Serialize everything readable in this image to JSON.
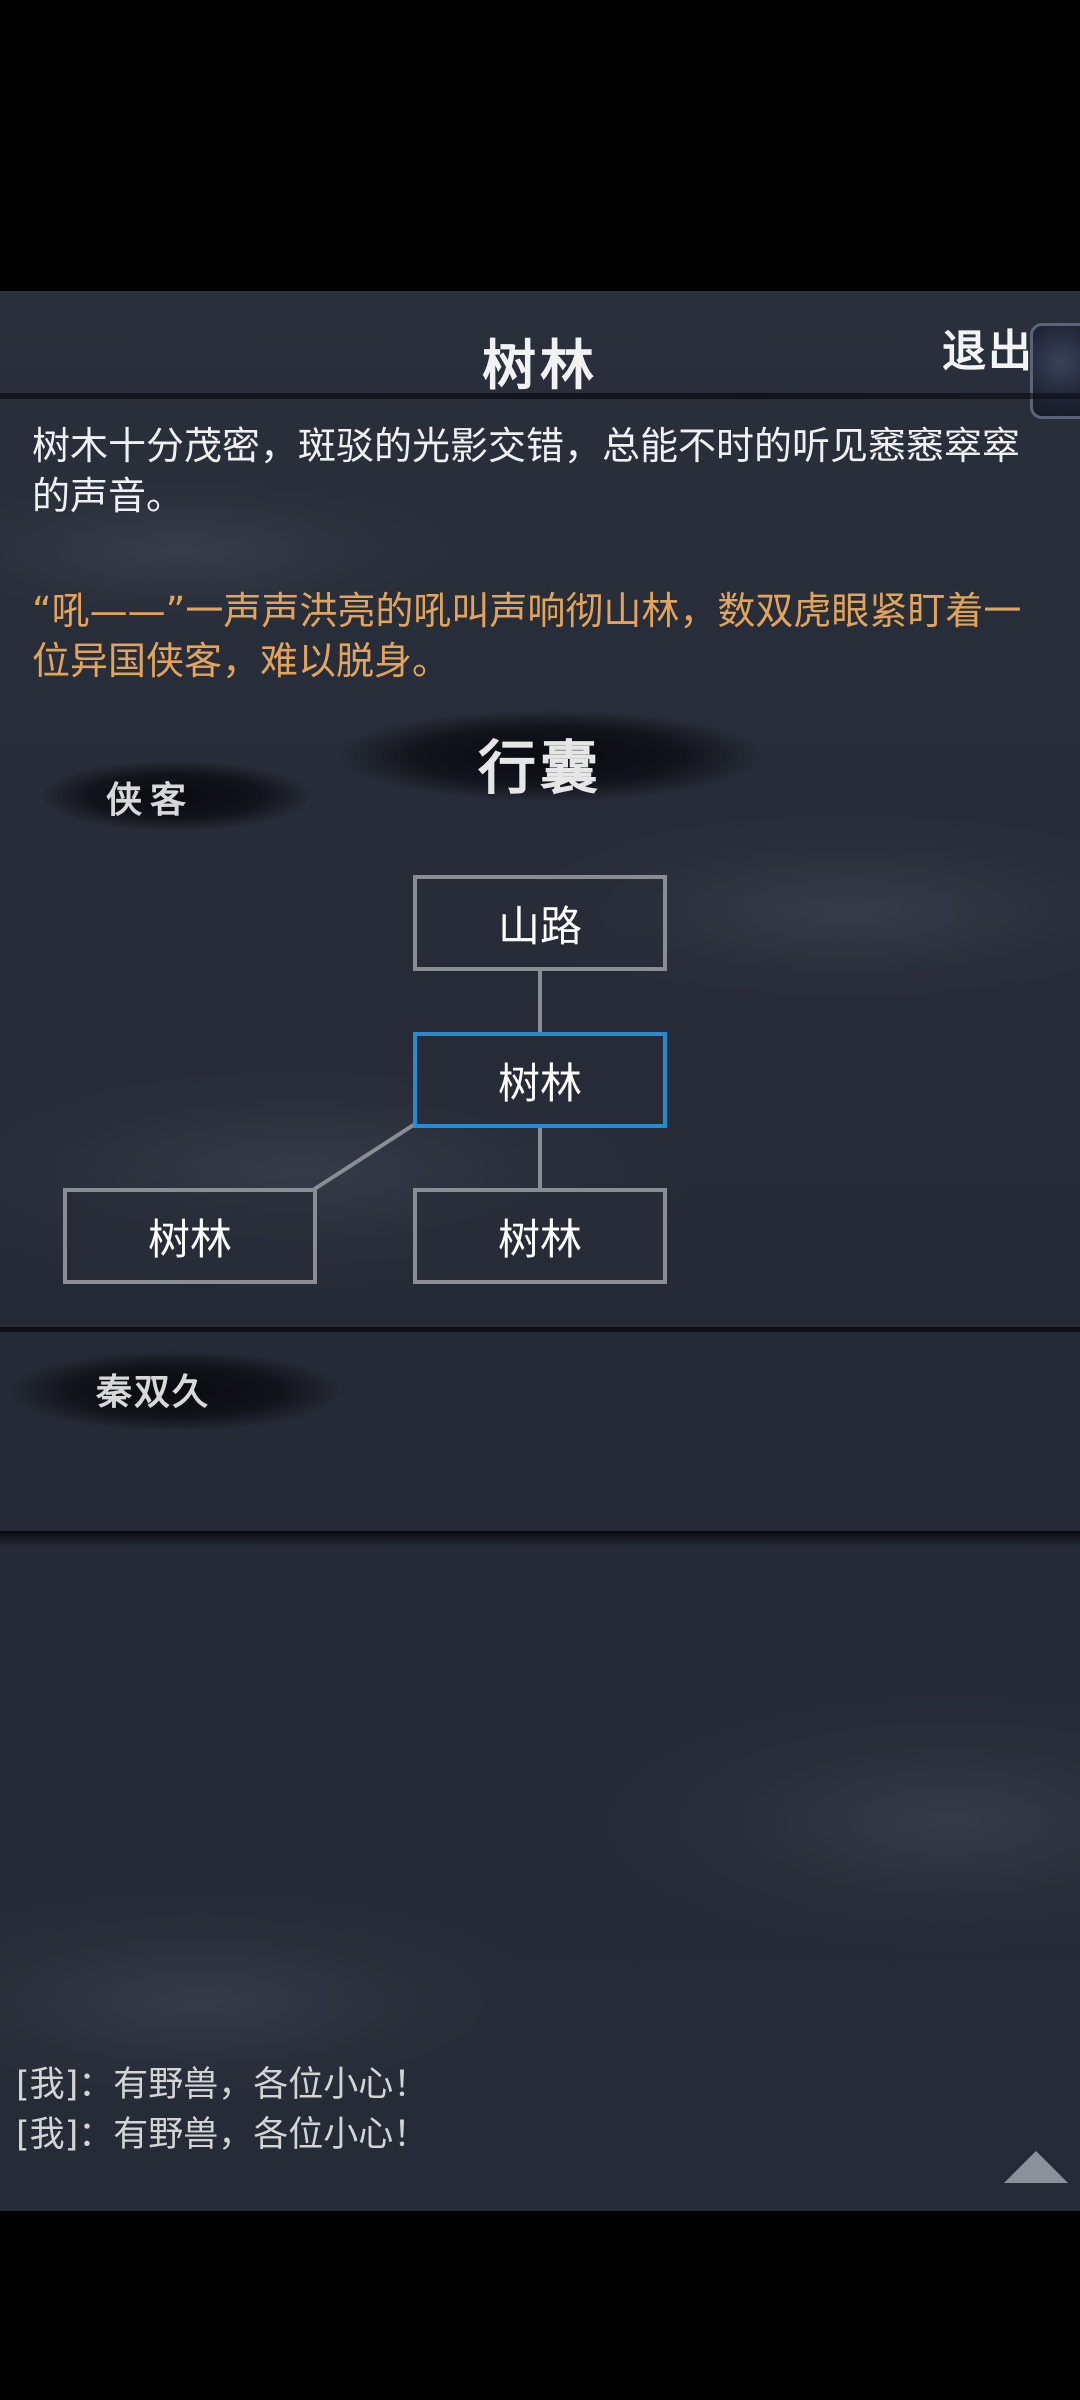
{
  "header": {
    "title": "树林",
    "exit_label": "退出"
  },
  "description": {
    "main": "树木十分茂密，斑驳的光影交错，总能不时的听见窸窸窣窣的声音。",
    "event": "“吼——”一声声洪亮的吼叫声响彻山林，数双虎眼紧盯着一位异国侠客，难以脱身。"
  },
  "map_panel": {
    "title": "行囊",
    "tab_label": "侠客",
    "nodes": {
      "top": "山路",
      "center": "树林",
      "bottom_left": "树林",
      "bottom_middle": "树林"
    },
    "current_node": "center",
    "colors": {
      "current_border": "#2a8ad0",
      "node_border": "#8a8d94"
    }
  },
  "character_panel": {
    "name": "秦双久"
  },
  "chat_log": [
    "[我]：有野兽，各位小心！",
    "[我]：有野兽，各位小心！"
  ],
  "icons": {
    "scroll_up": "triangle-up-icon",
    "exit_emblem": "scroll-emblem-icon"
  }
}
